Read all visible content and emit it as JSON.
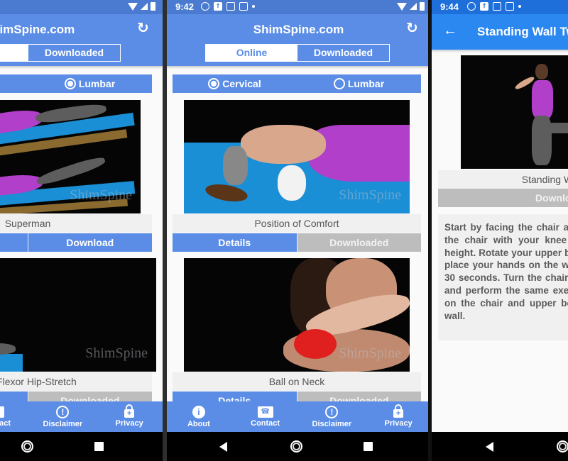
{
  "colors": {
    "primary": "#5b8de6",
    "status_bar": "#4a7bd1",
    "detail_appbar": "#2b88f0",
    "disabled": "#bdbdbd",
    "card_bg": "#f0f0f0"
  },
  "statusbar": {
    "screen2_time": "9:42",
    "screen3_time": "9:44",
    "notification_icons": [
      "timer-icon",
      "facebook-icon",
      "gmail-icon",
      "instagram-icon",
      "dot-icon"
    ],
    "system_icons": [
      "wifi-icon",
      "cell-signal-icon",
      "battery-icon"
    ]
  },
  "app": {
    "title": "ShimSpine.com",
    "refresh_icon": "refresh-icon",
    "tabs": [
      {
        "label": "Online",
        "active": true
      },
      {
        "label": "Downloaded",
        "active": false
      }
    ],
    "region_options": [
      {
        "label": "Cervical"
      },
      {
        "label": "Lumbar"
      }
    ]
  },
  "screen1": {
    "selected_tab": "Downloaded",
    "selected_region": "Lumbar",
    "cards": [
      {
        "title": "Superman",
        "details_label": "Details",
        "action_label": "Download",
        "action_state": "available"
      },
      {
        "title": "Hip Flexor Hip-Stretch",
        "details_label": "Details",
        "action_label": "Downloaded",
        "action_state": "downloaded"
      }
    ]
  },
  "screen2": {
    "selected_tab": "Online",
    "selected_region": "Cervical",
    "cards": [
      {
        "title": "Position of Comfort",
        "details_label": "Details",
        "action_label": "Downloaded",
        "action_state": "downloaded"
      },
      {
        "title": "Ball on Neck",
        "details_label": "Details",
        "action_label": "Downloaded",
        "action_state": "downloaded"
      }
    ]
  },
  "watermark": "ShimSpine",
  "bottom_nav": [
    {
      "label": "About",
      "icon": "info-icon",
      "glyph": "i"
    },
    {
      "label": "Contact",
      "icon": "contact-card-icon",
      "glyph": "☎"
    },
    {
      "label": "Disclaimer",
      "icon": "exclamation-circle-icon",
      "glyph": "!"
    },
    {
      "label": "Privacy",
      "icon": "lock-icon",
      "glyph": "+"
    }
  ],
  "detail": {
    "back_icon": "back-arrow-icon",
    "back_glyph": "←",
    "title": "Standing Wall Twist",
    "exercise_name": "Standing Wall Twist",
    "download_label": "Downloaded",
    "description": "Start by facing the chair and place your foot on to the chair with your knee bent at about shoulder height. Rotate your upper body towards the wall and place your hands on the wall. Hold this position for 30 seconds. Turn the chair in the opposite direction and perform the same exercise with your other leg on the chair and upper body rotating towards the wall."
  }
}
